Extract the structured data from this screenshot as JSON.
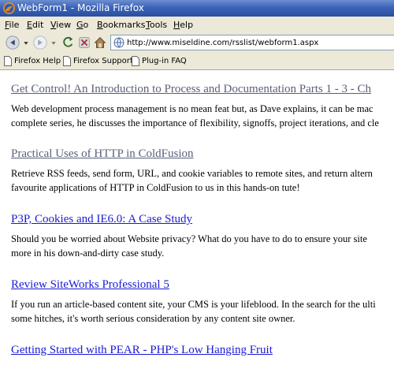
{
  "window": {
    "title": "WebForm1 - Mozilla Firefox"
  },
  "menu": {
    "items": [
      {
        "access_key": "F",
        "rest": "ile"
      },
      {
        "access_key": "E",
        "rest": "dit"
      },
      {
        "access_key": "V",
        "rest": "iew"
      },
      {
        "access_key": "G",
        "rest": "o"
      },
      {
        "access_key": "B",
        "rest": "ookmarks"
      },
      {
        "access_key": "T",
        "rest": "ools"
      },
      {
        "access_key": "H",
        "rest": "elp"
      }
    ]
  },
  "navigation": {
    "url": "http://www.miseldine.com/rsslist/webform1.aspx",
    "icons": [
      "back-arrow-icon",
      "dropdown-arrow-icon",
      "forward-arrow-icon",
      "reload-icon",
      "stop-icon",
      "home-icon",
      "site-icon"
    ]
  },
  "bookmarks": {
    "items": [
      "Firefox Help",
      "Firefox Support",
      "Plug-in FAQ"
    ]
  },
  "articles": [
    {
      "title": "Get Control! An Introduction to Process and Documentation Parts 1 - 3 - Ch",
      "visited": true,
      "desc_lines": [
        "Web development process management is no mean feat but, as Dave explains, it can be mac",
        "complete series, he discusses the importance of flexibility, signoffs, project iterations, and cle"
      ]
    },
    {
      "title": "Practical Uses of HTTP in ColdFusion",
      "visited": true,
      "desc_lines": [
        "Retrieve RSS feeds, send form, URL, and cookie variables to remote sites, and return altern",
        "favourite applications of HTTP in ColdFusion to us in this hands-on tute!"
      ]
    },
    {
      "title": "P3P, Cookies and IE6.0: A Case Study",
      "visited": false,
      "desc_lines": [
        "Should you be worried about Website privacy? What do you have to do to ensure your site",
        "more in his down-and-dirty case study."
      ]
    },
    {
      "title": "Review SiteWorks Professional 5",
      "visited": false,
      "desc_lines": [
        "If you run an article-based content site, your CMS is your lifeblood. In the search for the ulti",
        "some hitches, it's worth serious consideration by any content site owner."
      ]
    },
    {
      "title": "Getting Started with PEAR - PHP's Low Hanging Fruit",
      "visited": false,
      "desc_lines": []
    }
  ],
  "colors": {
    "titlebar": "#3b63b8",
    "chrome": "#ece9d8",
    "visited_link": "#5a5f79",
    "link": "#1a1ad6"
  }
}
